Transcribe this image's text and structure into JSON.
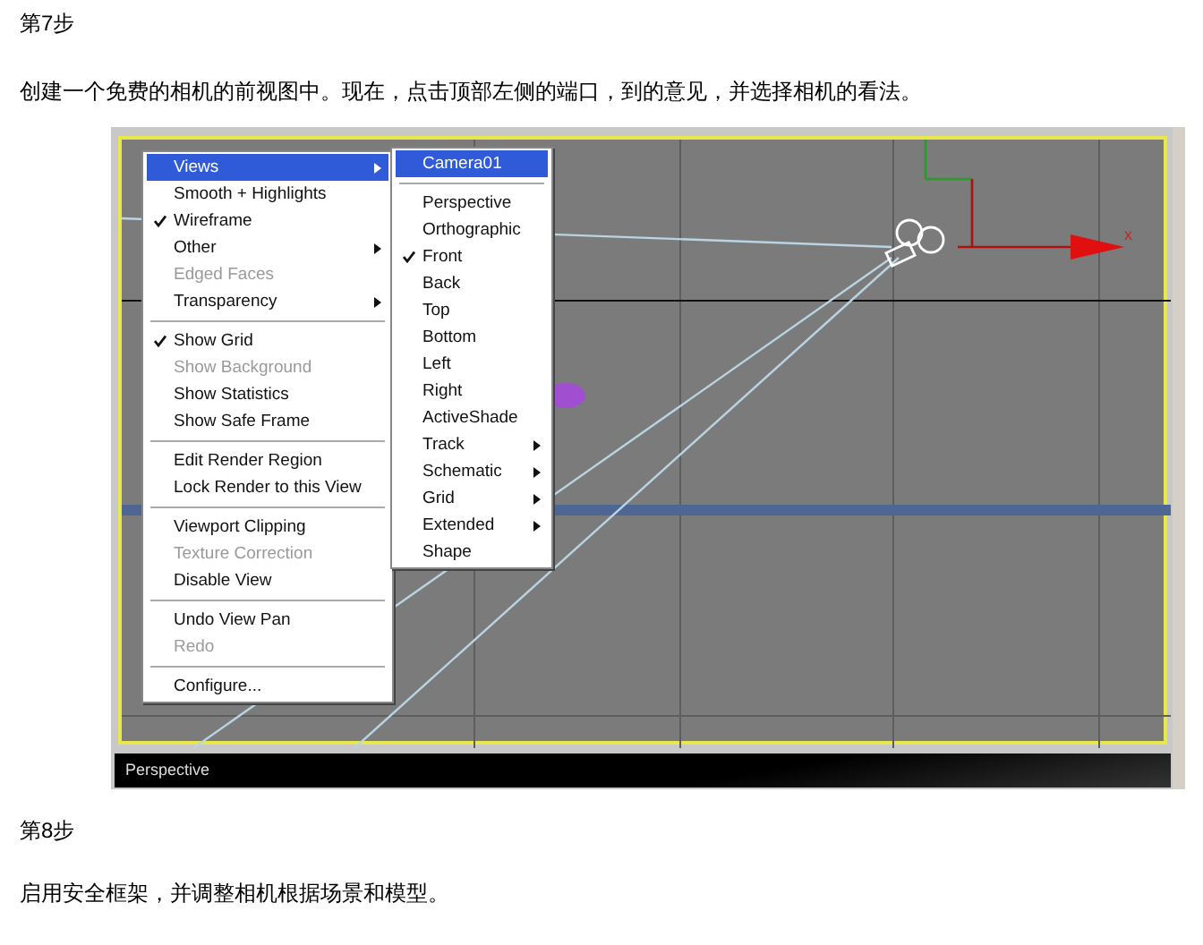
{
  "step_7": {
    "title": "第7步",
    "instruction": "创建一个免费的相机的前视图中。现在，点击顶部左侧的端口，到的意见，并选择相机的看法。"
  },
  "screenshot": {
    "main_menu": [
      [
        {
          "label": "Views",
          "selected": true,
          "checked": false,
          "disabled": false,
          "submenu": true
        },
        {
          "label": "Smooth + Highlights",
          "selected": false,
          "checked": false,
          "disabled": false,
          "submenu": false
        },
        {
          "label": "Wireframe",
          "selected": false,
          "checked": true,
          "disabled": false,
          "submenu": false
        },
        {
          "label": "Other",
          "selected": false,
          "checked": false,
          "disabled": false,
          "submenu": true
        },
        {
          "label": "Edged Faces",
          "selected": false,
          "checked": false,
          "disabled": true,
          "submenu": false
        },
        {
          "label": "Transparency",
          "selected": false,
          "checked": false,
          "disabled": false,
          "submenu": true
        }
      ],
      [
        {
          "label": "Show Grid",
          "selected": false,
          "checked": true,
          "disabled": false,
          "submenu": false
        },
        {
          "label": "Show Background",
          "selected": false,
          "checked": false,
          "disabled": true,
          "submenu": false
        },
        {
          "label": "Show Statistics",
          "selected": false,
          "checked": false,
          "disabled": false,
          "submenu": false
        },
        {
          "label": "Show Safe Frame",
          "selected": false,
          "checked": false,
          "disabled": false,
          "submenu": false
        }
      ],
      [
        {
          "label": "Edit Render Region",
          "selected": false,
          "checked": false,
          "disabled": false,
          "submenu": false
        },
        {
          "label": "Lock Render to this View",
          "selected": false,
          "checked": false,
          "disabled": false,
          "submenu": false
        }
      ],
      [
        {
          "label": "Viewport Clipping",
          "selected": false,
          "checked": false,
          "disabled": false,
          "submenu": false
        },
        {
          "label": "Texture Correction",
          "selected": false,
          "checked": false,
          "disabled": true,
          "submenu": false
        },
        {
          "label": "Disable View",
          "selected": false,
          "checked": false,
          "disabled": false,
          "submenu": false
        }
      ],
      [
        {
          "label": "Undo View Pan",
          "selected": false,
          "checked": false,
          "disabled": false,
          "submenu": false
        },
        {
          "label": "Redo",
          "selected": false,
          "checked": false,
          "disabled": true,
          "submenu": false
        }
      ],
      [
        {
          "label": "Configure...",
          "selected": false,
          "checked": false,
          "disabled": false,
          "submenu": false
        }
      ]
    ],
    "views_submenu": [
      [
        {
          "label": "Camera01",
          "selected": true,
          "checked": false,
          "submenu": false
        }
      ],
      [
        {
          "label": "Perspective",
          "selected": false,
          "checked": false,
          "submenu": false
        },
        {
          "label": "Orthographic",
          "selected": false,
          "checked": false,
          "submenu": false
        },
        {
          "label": "Front",
          "selected": false,
          "checked": true,
          "submenu": false
        },
        {
          "label": "Back",
          "selected": false,
          "checked": false,
          "submenu": false
        },
        {
          "label": "Top",
          "selected": false,
          "checked": false,
          "submenu": false
        },
        {
          "label": "Bottom",
          "selected": false,
          "checked": false,
          "submenu": false
        },
        {
          "label": "Left",
          "selected": false,
          "checked": false,
          "submenu": false
        },
        {
          "label": "Right",
          "selected": false,
          "checked": false,
          "submenu": false
        },
        {
          "label": "ActiveShade",
          "selected": false,
          "checked": false,
          "submenu": false
        },
        {
          "label": "Track",
          "selected": false,
          "checked": false,
          "submenu": true
        },
        {
          "label": "Schematic",
          "selected": false,
          "checked": false,
          "submenu": true
        },
        {
          "label": "Grid",
          "selected": false,
          "checked": false,
          "submenu": true
        },
        {
          "label": "Extended",
          "selected": false,
          "checked": false,
          "submenu": true
        },
        {
          "label": "Shape",
          "selected": false,
          "checked": false,
          "submenu": false
        }
      ]
    ],
    "axis_label": "x",
    "viewport_label": "Perspective"
  },
  "step_8": {
    "title": "第8步",
    "instruction": "启用安全框架，并调整相机根据场景和模型。"
  }
}
